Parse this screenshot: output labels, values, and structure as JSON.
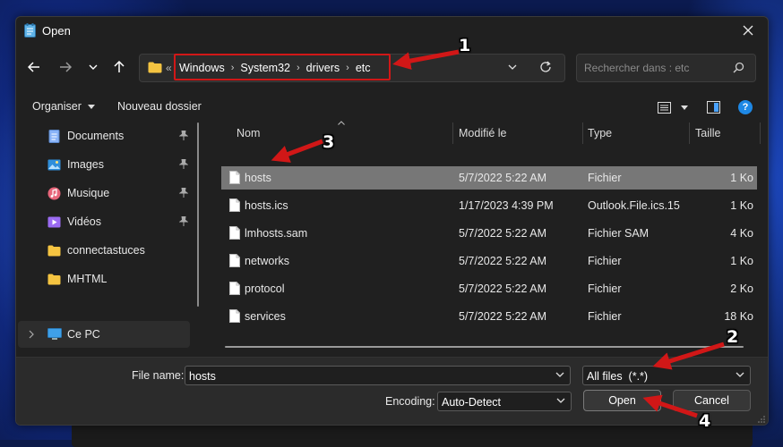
{
  "window": {
    "title": "Open"
  },
  "nav": {
    "back_icon": "arrow-left-icon",
    "forward_icon": "arrow-right-icon",
    "recent_icon": "chevron-down-icon",
    "up_icon": "arrow-up-icon",
    "overflow": "«",
    "breadcrumbs": [
      "Windows",
      "System32",
      "drivers",
      "etc"
    ],
    "refresh_icon": "refresh-icon",
    "search_placeholder": "Rechercher dans : etc"
  },
  "toolbar": {
    "organize": "Organiser",
    "new_folder": "Nouveau dossier"
  },
  "sidebar": {
    "items": [
      {
        "label": "Documents",
        "icon": "documents-icon",
        "pinned": true
      },
      {
        "label": "Images",
        "icon": "images-icon",
        "pinned": true
      },
      {
        "label": "Musique",
        "icon": "music-icon",
        "pinned": true
      },
      {
        "label": "Vidéos",
        "icon": "videos-icon",
        "pinned": true
      },
      {
        "label": "connectastuces",
        "icon": "folder-icon",
        "pinned": false
      },
      {
        "label": "MHTML",
        "icon": "folder-icon",
        "pinned": false
      }
    ],
    "this_pc": "Ce PC"
  },
  "columns": {
    "name": "Nom",
    "modified": "Modifié le",
    "type": "Type",
    "size": "Taille"
  },
  "files": [
    {
      "name": "hosts",
      "modified": "5/7/2022 5:22 AM",
      "type": "Fichier",
      "size": "1 Ko",
      "selected": true
    },
    {
      "name": "hosts.ics",
      "modified": "1/17/2023 4:39 PM",
      "type": "Outlook.File.ics.15",
      "size": "1 Ko",
      "selected": false
    },
    {
      "name": "lmhosts.sam",
      "modified": "5/7/2022 5:22 AM",
      "type": "Fichier SAM",
      "size": "4 Ko",
      "selected": false
    },
    {
      "name": "networks",
      "modified": "5/7/2022 5:22 AM",
      "type": "Fichier",
      "size": "1 Ko",
      "selected": false
    },
    {
      "name": "protocol",
      "modified": "5/7/2022 5:22 AM",
      "type": "Fichier",
      "size": "2 Ko",
      "selected": false
    },
    {
      "name": "services",
      "modified": "5/7/2022 5:22 AM",
      "type": "Fichier",
      "size": "18 Ko",
      "selected": false
    }
  ],
  "bottom": {
    "filename_label": "File name:",
    "filename_value": "hosts",
    "filter_value": "All files  (*.*)",
    "encoding_label": "Encoding:",
    "encoding_value": "Auto-Detect",
    "open": "Open",
    "cancel": "Cancel"
  },
  "annotations": {
    "n1": "1",
    "n2": "2",
    "n3": "3",
    "n4": "4",
    "color": "#d11717"
  },
  "colors": {
    "dialog_bg": "#202020",
    "selected_row": "#777777",
    "accent_help": "#1e88e5"
  }
}
